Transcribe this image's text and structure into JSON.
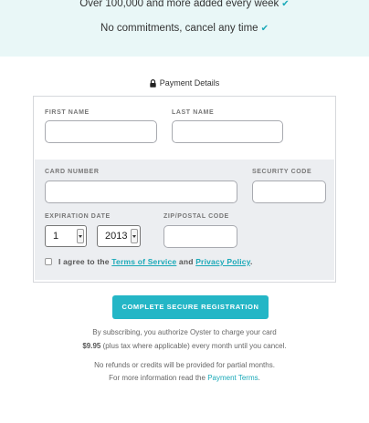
{
  "banner": {
    "line1": "Over 100,000 and more added every week",
    "line2": "No commitments, cancel any time",
    "check_icon": "check-icon",
    "bg_color": "#e9f7f7"
  },
  "payment": {
    "title": "Payment Details",
    "lock_icon": "lock-icon"
  },
  "form": {
    "first_name_label": "FIRST NAME",
    "first_name_value": "",
    "last_name_label": "LAST NAME",
    "last_name_value": "",
    "card_number_label": "CARD NUMBER",
    "card_number_value": "",
    "security_code_label": "SECURITY CODE",
    "security_code_value": "",
    "expiration_label": "EXPIRATION DATE",
    "exp_month": "1",
    "exp_year": "2013",
    "zip_label": "ZIP/POSTAL CODE",
    "zip_value": "",
    "agree_prefix": "I agree to the",
    "terms_link": "Terms of Service",
    "agree_and": "and",
    "privacy_link": "Privacy Policy",
    "agree_suffix": "."
  },
  "cta": {
    "label": "COMPLETE SECURE REGISTRATION",
    "color": "#24b6c6"
  },
  "notes": {
    "line1": "By subscribing, you authorize Oyster to charge your card",
    "price": "$9.95",
    "line2_rest": "(plus tax where applicable) every month until you cancel.",
    "line3": "No refunds or credits will be provided for partial months.",
    "line4_prefix": "For more information read the",
    "payment_terms_link": "Payment Terms",
    "line4_suffix": "."
  },
  "accent_color": "#1aa9b8"
}
